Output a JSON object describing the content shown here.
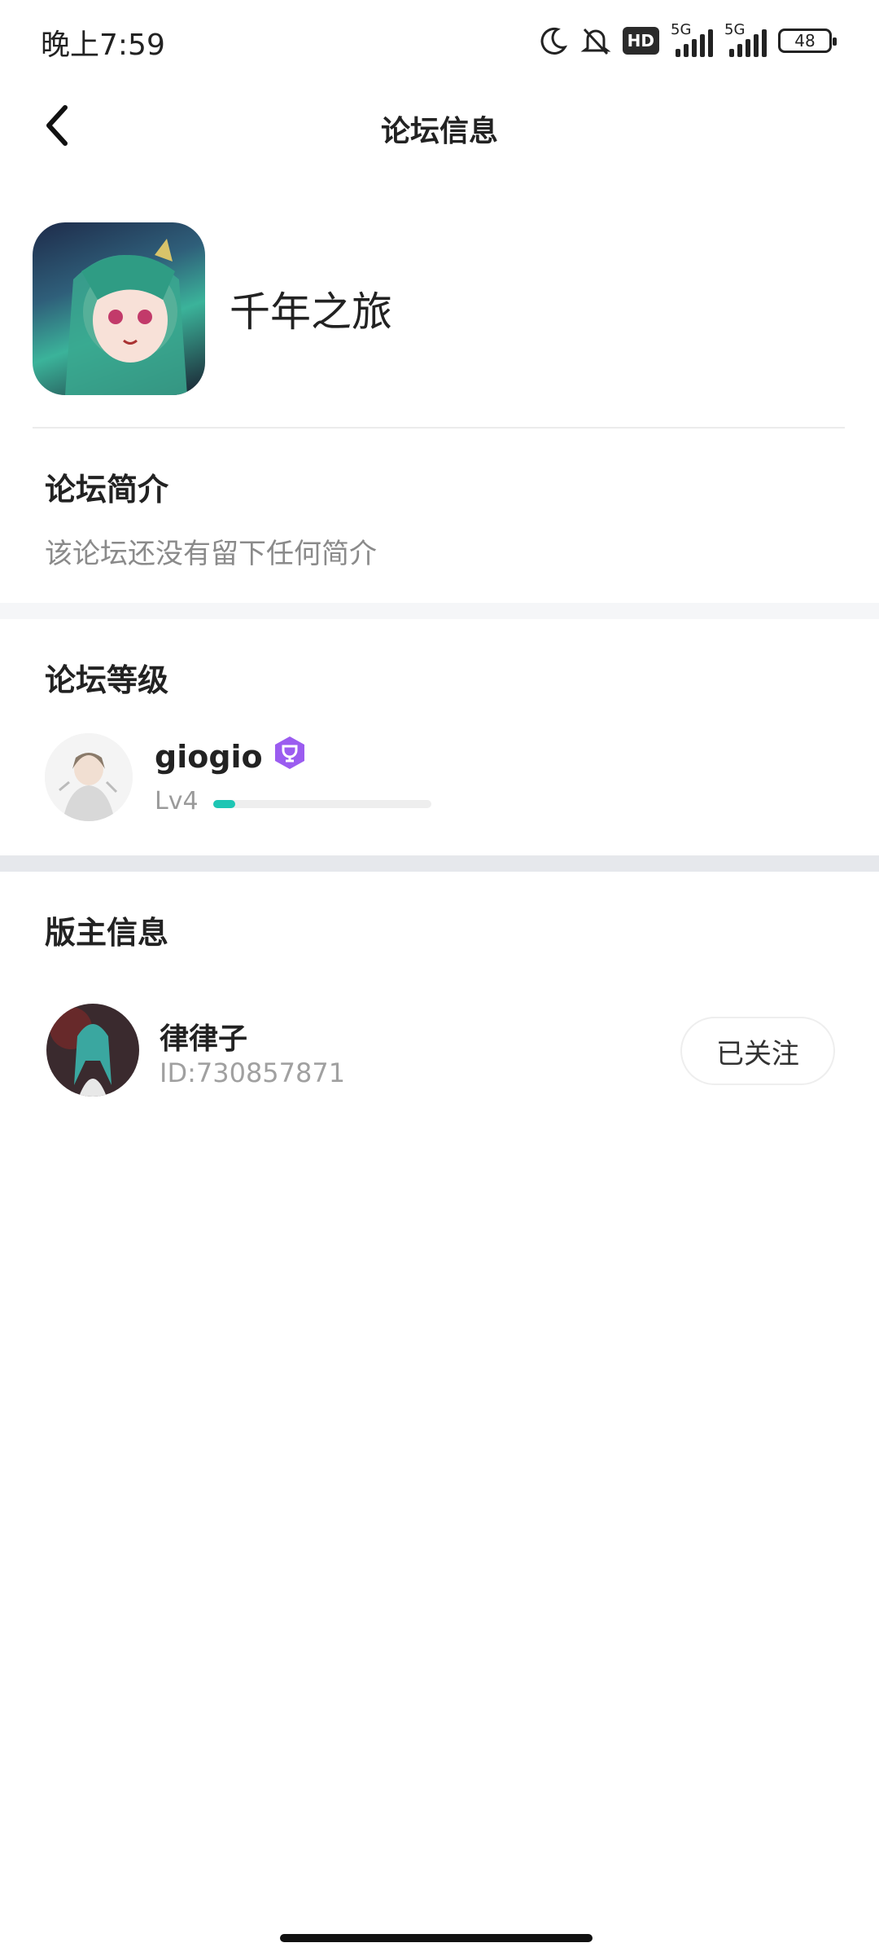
{
  "status_bar": {
    "time": "晚上7:59",
    "hd_label": "HD",
    "signal1_label": "5G",
    "signal2_label": "5G",
    "battery": "48"
  },
  "header": {
    "title": "论坛信息"
  },
  "forum": {
    "name": "千年之旅"
  },
  "intro": {
    "title": "论坛简介",
    "text": "该论坛还没有留下任何简介"
  },
  "level": {
    "title": "论坛等级",
    "username": "giogio",
    "level_label": "Lv4",
    "progress": 0.1,
    "accent_color": "#1ec6b4",
    "badge_color": "#9b5cf0"
  },
  "moderator": {
    "title": "版主信息",
    "name": "律律子",
    "id_text": "ID:730857871",
    "follow_label": "已关注"
  }
}
